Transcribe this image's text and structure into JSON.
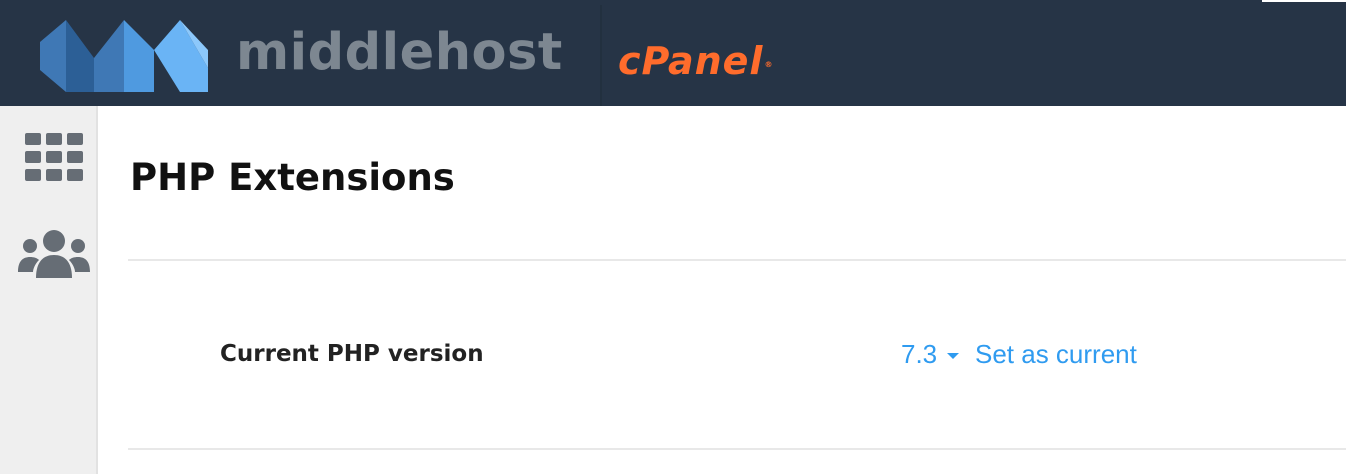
{
  "header": {
    "brand_name": "middlehost",
    "cpanel_logo": "cPanel",
    "cpanel_trademark": "®",
    "logo_icon": "middlehost-logo-icon",
    "background_color": "#263446",
    "brand_color": "#7d8791",
    "cpanel_color": "#ff6c2c"
  },
  "sidebar": {
    "items": [
      {
        "icon": "grid-icon"
      },
      {
        "icon": "users-icon"
      }
    ]
  },
  "main": {
    "title": "PHP Extensions",
    "php_version_row": {
      "label": "Current PHP version",
      "selected_version": "7.3",
      "action_label": "Set as current",
      "link_color": "#2f9bf0"
    }
  }
}
